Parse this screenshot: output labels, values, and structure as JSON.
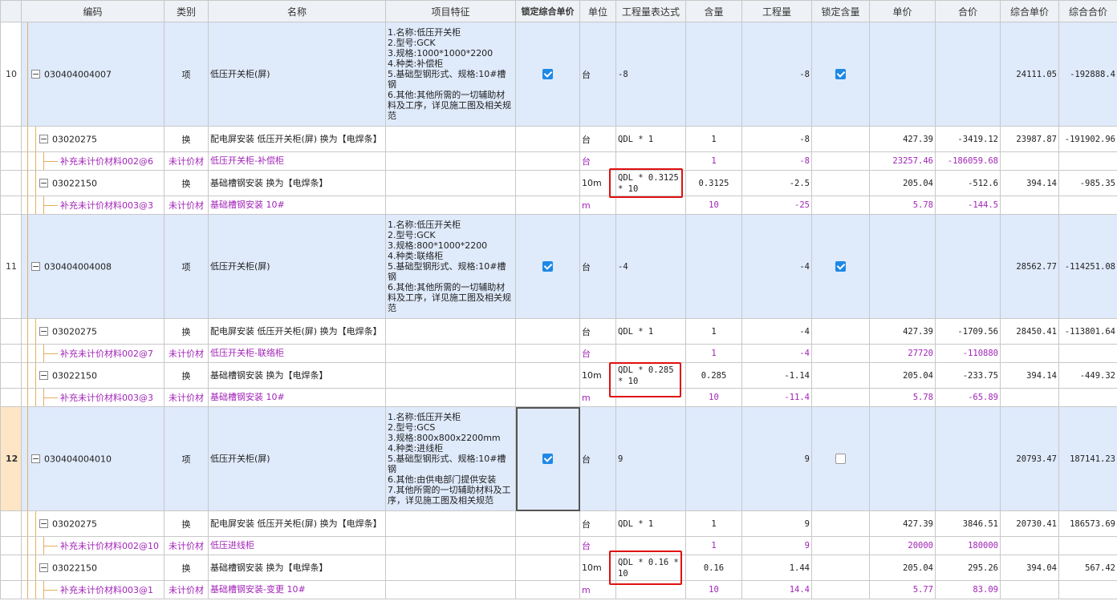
{
  "headers": [
    "编码",
    "类别",
    "名称",
    "项目特征",
    "锁定综合单价",
    "单位",
    "工程量表达式",
    "含量",
    "工程量",
    "锁定含量",
    "单价",
    "合价",
    "综合单价",
    "综合合价"
  ],
  "rows": [
    {
      "type": "main",
      "idx": "10",
      "code": "030404004007",
      "cat": "项",
      "name": "低压开关柜(屏)",
      "feature": "1.名称:低压开关柜\n2.型号:GCK\n3.规格:1000*1000*2200\n4.种类:补偿柜\n5.基础型钢形式、规格:10#槽钢\n6.其他:其他所需的一切辅助材料及工序，详见施工图及相关规范",
      "lockprice": true,
      "unit": "台",
      "expr": "-8",
      "content": "",
      "qty": "-8",
      "lockqty": true,
      "price": "",
      "total": "",
      "cprice": "24111.05",
      "ctotal": "-192888.4"
    },
    {
      "type": "sub",
      "code": "03020275",
      "cat": "换",
      "name": "配电屏安装 低压开关柜(屏)  换为【电焊条】",
      "unit": "台",
      "expr": "QDL * 1",
      "content": "1",
      "qty": "-8",
      "price": "427.39",
      "total": "-3419.12",
      "cprice": "23987.87",
      "ctotal": "-191902.96"
    },
    {
      "type": "mat",
      "code": "补充未计价材料002@6",
      "cat": "未计价材",
      "name": "低压开关柜-补偿柜",
      "unit": "台",
      "expr": "",
      "content": "1",
      "qty": "-8",
      "price": "23257.46",
      "total": "-186059.68",
      "cprice": "",
      "ctotal": ""
    },
    {
      "type": "sub",
      "code": "03022150",
      "cat": "换",
      "name": "基础槽钢安装  换为【电焊条】",
      "unit": "10m",
      "expr": "QDL * 0.3125 * 10",
      "content": "0.3125",
      "qty": "-2.5",
      "price": "205.04",
      "total": "-512.6",
      "cprice": "394.14",
      "ctotal": "-985.35"
    },
    {
      "type": "mat",
      "code": "补充未计价材料003@3",
      "cat": "未计价材",
      "name": "基础槽钢安装 10#",
      "unit": "m",
      "expr": "",
      "content": "10",
      "qty": "-25",
      "price": "5.78",
      "total": "-144.5",
      "cprice": "",
      "ctotal": ""
    },
    {
      "type": "main",
      "idx": "11",
      "code": "030404004008",
      "cat": "项",
      "name": "低压开关柜(屏)",
      "feature": "1.名称:低压开关柜\n2.型号:GCK\n3.规格:800*1000*2200\n4.种类:联络柜\n5.基础型钢形式、规格:10#槽钢\n6.其他:其他所需的一切辅助材料及工序，详见施工图及相关规范",
      "lockprice": true,
      "unit": "台",
      "expr": "-4",
      "content": "",
      "qty": "-4",
      "lockqty": true,
      "price": "",
      "total": "",
      "cprice": "28562.77",
      "ctotal": "-114251.08"
    },
    {
      "type": "sub",
      "code": "03020275",
      "cat": "换",
      "name": "配电屏安装 低压开关柜(屏)  换为【电焊条】",
      "unit": "台",
      "expr": "QDL * 1",
      "content": "1",
      "qty": "-4",
      "price": "427.39",
      "total": "-1709.56",
      "cprice": "28450.41",
      "ctotal": "-113801.64"
    },
    {
      "type": "mat",
      "code": "补充未计价材料002@7",
      "cat": "未计价材",
      "name": "低压开关柜-联络柜",
      "unit": "台",
      "expr": "",
      "content": "1",
      "qty": "-4",
      "price": "27720",
      "total": "-110880",
      "cprice": "",
      "ctotal": ""
    },
    {
      "type": "sub",
      "code": "03022150",
      "cat": "换",
      "name": "基础槽钢安装  换为【电焊条】",
      "unit": "10m",
      "expr": "QDL * 0.285 * 10",
      "content": "0.285",
      "qty": "-1.14",
      "price": "205.04",
      "total": "-233.75",
      "cprice": "394.14",
      "ctotal": "-449.32"
    },
    {
      "type": "mat",
      "code": "补充未计价材料003@3",
      "cat": "未计价材",
      "name": "基础槽钢安装 10#",
      "unit": "m",
      "expr": "",
      "content": "10",
      "qty": "-11.4",
      "price": "5.78",
      "total": "-65.89",
      "cprice": "",
      "ctotal": ""
    },
    {
      "type": "main",
      "idx": "12",
      "selected": true,
      "code": "030404004010",
      "cat": "项",
      "name": "低压开关柜(屏)",
      "feature": "1.名称:低压开关柜\n2.型号:GCS\n3.规格:800x800x2200mm\n4.种类:进线柜\n5.基础型钢形式、规格:10#槽钢\n6.其他:由供电部门提供安装\n7.其他所需的一切辅助材料及工序，详见施工图及相关规范",
      "lockprice": true,
      "unit": "台",
      "expr": "9",
      "content": "",
      "qty": "9",
      "lockqty": false,
      "price": "",
      "total": "",
      "cprice": "20793.47",
      "ctotal": "187141.23"
    },
    {
      "type": "sub",
      "code": "03020275",
      "cat": "换",
      "name": "配电屏安装 低压开关柜(屏)  换为【电焊条】",
      "unit": "台",
      "expr": "QDL * 1",
      "content": "1",
      "qty": "9",
      "price": "427.39",
      "total": "3846.51",
      "cprice": "20730.41",
      "ctotal": "186573.69"
    },
    {
      "type": "mat",
      "code": "补充未计价材料002@10",
      "cat": "未计价材",
      "name": "低压进线柜",
      "unit": "台",
      "expr": "",
      "content": "1",
      "qty": "9",
      "price": "20000",
      "total": "180000",
      "cprice": "",
      "ctotal": ""
    },
    {
      "type": "sub",
      "code": "03022150",
      "cat": "换",
      "name": "基础槽钢安装  换为【电焊条】",
      "unit": "10m",
      "expr": "QDL * 0.16 * 10",
      "content": "0.16",
      "qty": "1.44",
      "price": "205.04",
      "total": "295.26",
      "cprice": "394.04",
      "ctotal": "567.42"
    },
    {
      "type": "mat",
      "code": "补充未计价材料003@1",
      "cat": "未计价材",
      "name": "基础槽钢安装-变更 10#",
      "unit": "m",
      "expr": "",
      "content": "10",
      "qty": "14.4",
      "price": "5.77",
      "total": "83.09",
      "cprice": "",
      "ctotal": ""
    }
  ]
}
